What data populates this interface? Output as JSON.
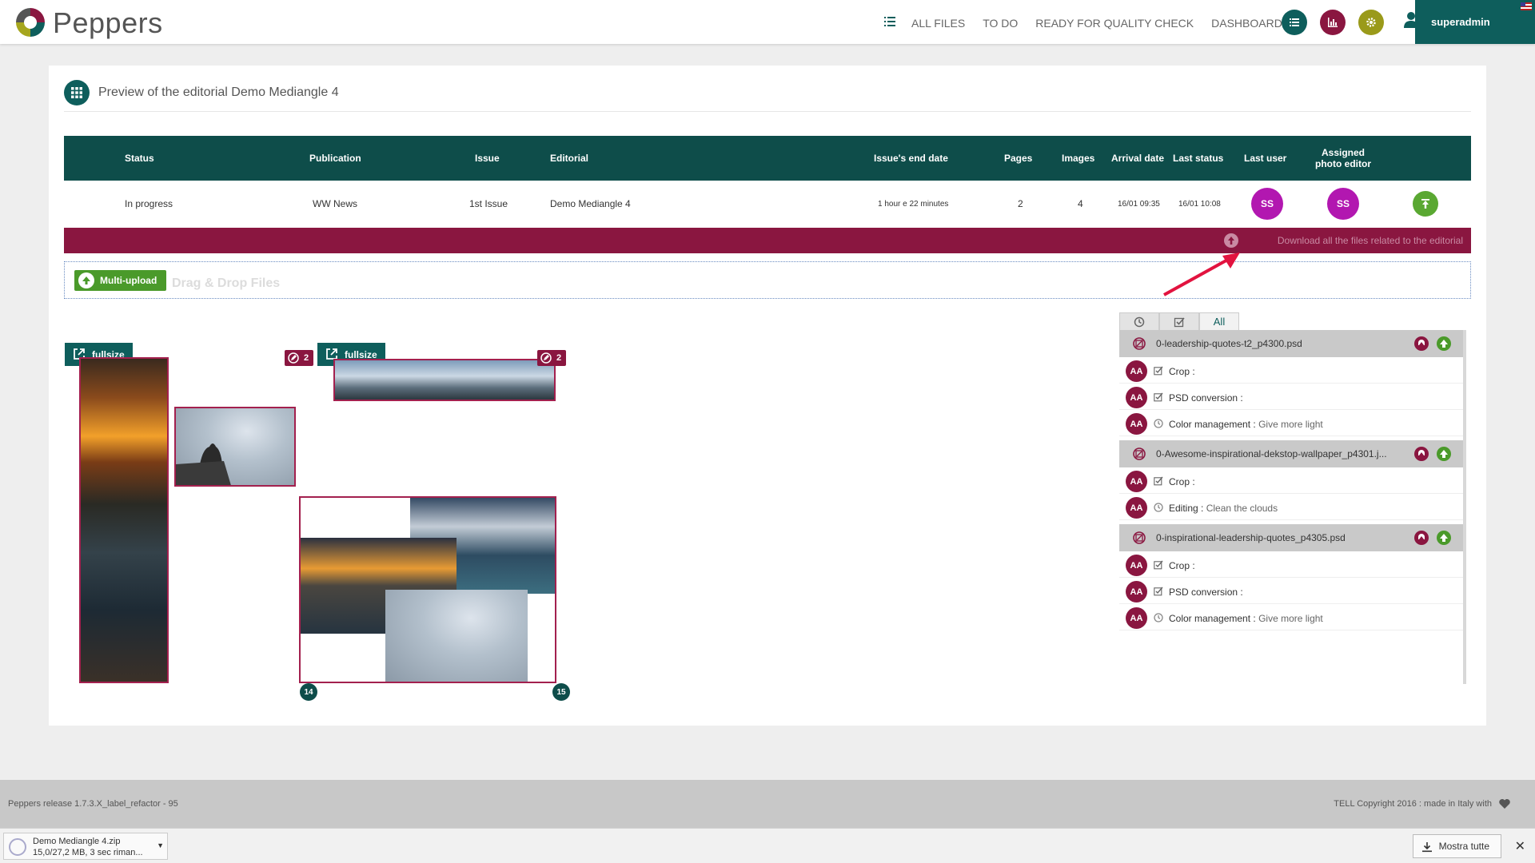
{
  "app": {
    "name": "Peppers"
  },
  "nav": {
    "items": [
      "ALL FILES",
      "TO DO",
      "READY FOR QUALITY CHECK",
      "DASHBOARD"
    ]
  },
  "user": {
    "name": "superadmin"
  },
  "colors": {
    "teal": "#0e5e5c",
    "dark_teal": "#0e4d4a",
    "maroon": "#8a1640",
    "olive": "#9a9a1a",
    "purple": "#b217b0",
    "green": "#5aa832"
  },
  "page": {
    "title": "Preview of the editorial Demo Mediangle 4"
  },
  "table": {
    "headers": {
      "status": "Status",
      "publication": "Publication",
      "issue": "Issue",
      "editorial": "Editorial",
      "end_date": "Issue's end date",
      "pages": "Pages",
      "images": "Images",
      "arrival": "Arrival date",
      "last_status": "Last status",
      "last_user": "Last user",
      "assigned_1": "Assigned",
      "assigned_2": "photo editor"
    },
    "row": {
      "status": "In progress",
      "publication": "WW News",
      "issue": "1st Issue",
      "editorial": "Demo Mediangle 4",
      "end_date": "1 hour e 22 minutes",
      "pages": "2",
      "images": "4",
      "arrival": "16/01 09:35",
      "last_status": "16/01 10:08",
      "last_user": "SS",
      "assigned": "SS"
    }
  },
  "download": {
    "label": "Download all the files related to the editorial"
  },
  "upload": {
    "button": "Multi-upload",
    "dropzone": "Drag & Drop Files"
  },
  "preview": {
    "fullsize_label": "fullsize",
    "badge_count": "2",
    "page_numbers": [
      "14",
      "15"
    ]
  },
  "panel": {
    "tab_all": "All",
    "files": [
      {
        "name": "0-leadership-quotes-t2_p4300.psd",
        "tasks": [
          {
            "user": "AA",
            "icon": "check-icon",
            "label": "Crop :",
            "value": ""
          },
          {
            "user": "AA",
            "icon": "check-icon",
            "label": "PSD conversion :",
            "value": ""
          },
          {
            "user": "AA",
            "icon": "clock-icon",
            "label": "Color management :",
            "value": " Give more light"
          }
        ]
      },
      {
        "name": "0-Awesome-inspirational-dekstop-wallpaper_p4301.j...",
        "tasks": [
          {
            "user": "AA",
            "icon": "check-icon",
            "label": "Crop :",
            "value": ""
          },
          {
            "user": "AA",
            "icon": "clock-icon",
            "label": "Editing :",
            "value": " Clean the clouds"
          }
        ]
      },
      {
        "name": "0-inspirational-leadership-quotes_p4305.psd",
        "tasks": [
          {
            "user": "AA",
            "icon": "check-icon",
            "label": "Crop :",
            "value": ""
          },
          {
            "user": "AA",
            "icon": "check-icon",
            "label": "PSD conversion :",
            "value": ""
          },
          {
            "user": "AA",
            "icon": "clock-icon",
            "label": "Color management :",
            "value": " Give more light"
          }
        ]
      }
    ]
  },
  "footer": {
    "left": "Peppers release 1.7.3.X_label_refactor - 95",
    "right": "TELL Copyright 2016 : made in Italy with"
  },
  "downloads_bar": {
    "file": "Demo Mediangle 4.zip",
    "status": "15,0/27,2 MB, 3 sec riman...",
    "show_all": "Mostra tutte"
  }
}
